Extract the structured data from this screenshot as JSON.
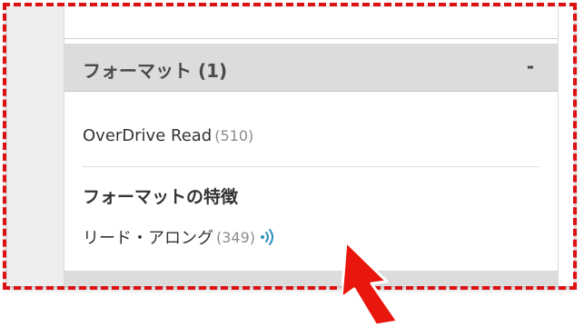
{
  "colors": {
    "annotation": "#dd1111",
    "header_bg": "#dcdcdc",
    "icon": "#2a8fbd",
    "count": "#8c8c8c"
  },
  "facet": {
    "title": "フォーマット (1)",
    "toggle": "-"
  },
  "formats": [
    {
      "label": "OverDrive Read",
      "count": "(510)"
    }
  ],
  "features": {
    "heading": "フォーマットの特徴",
    "items": [
      {
        "label": "リード・アロング",
        "count": "(349)",
        "icon": "read-along-icon"
      }
    ]
  },
  "annotation": {
    "icon": "arrow-pointer-icon"
  }
}
